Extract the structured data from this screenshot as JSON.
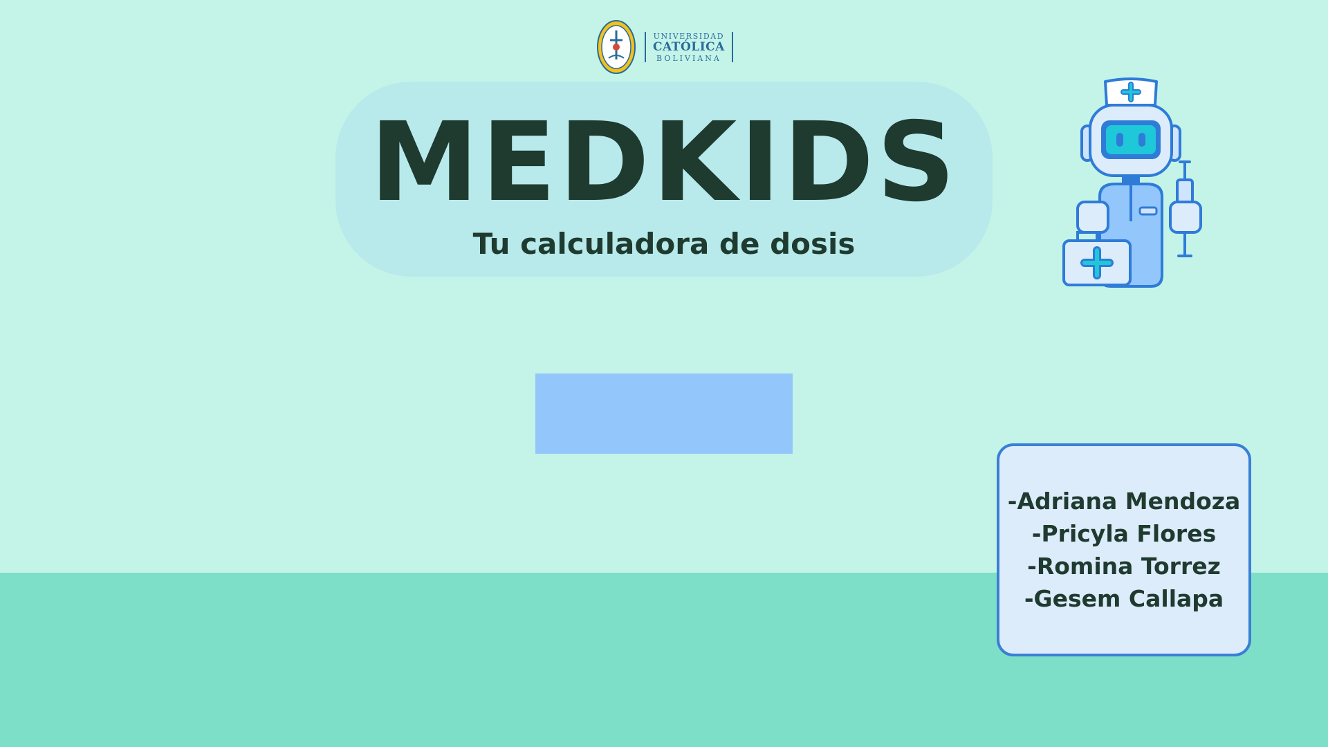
{
  "logo": {
    "line1": "UNIVERSIDAD",
    "line2": "CATÓLICA",
    "line3": "BOLIVIANA",
    "icon": "university-seal-icon"
  },
  "title": {
    "main": "MEDKIDS",
    "subtitle": "Tu calculadora de dosis"
  },
  "start_button": {
    "label": ""
  },
  "robot": {
    "icon": "nurse-robot-icon"
  },
  "authors": [
    "-Adriana Mendoza",
    "-Pricyla Flores",
    "-Romina Torrez",
    "-Gesem Callapa"
  ],
  "colors": {
    "background": "#c4f4e8",
    "band": "#7ddfc8",
    "title_pill": "#b8eaec",
    "title_text": "#1f3a2f",
    "button": "#93c6fb",
    "card_border": "#3a7fd5",
    "card_fill": "#dcecfb"
  }
}
